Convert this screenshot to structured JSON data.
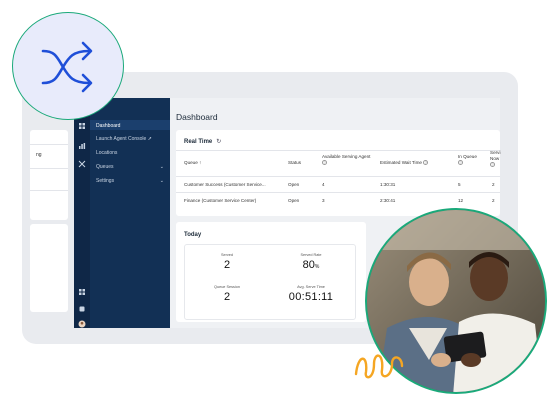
{
  "nav": {
    "items": [
      {
        "label": "Dashboard",
        "active": true
      },
      {
        "label": "Launch Agent Console",
        "icon": "external-link-icon"
      },
      {
        "label": "Locations"
      },
      {
        "label": "Queues",
        "expandable": true
      },
      {
        "label": "Settings",
        "expandable": true
      }
    ]
  },
  "left_pane": {
    "label": "ng"
  },
  "page": {
    "title": "Dashboard"
  },
  "realtime": {
    "title": "Real Time",
    "columns": [
      {
        "label": "Queue",
        "sort": "asc"
      },
      {
        "label": "Status"
      },
      {
        "label": "Available Serving Agent",
        "info": true
      },
      {
        "label": "Estimated Wait Time",
        "info": true
      },
      {
        "label": "In Queue",
        "info": true
      },
      {
        "label": "Servi Now",
        "info": true
      }
    ],
    "rows": [
      [
        "Customer Success (Customer Service...",
        "Open",
        "4",
        "1:30:31",
        "5",
        "2"
      ],
      [
        "Finance (Customer Service Center)",
        "Open",
        "3",
        "2:30:41",
        "12",
        "2"
      ]
    ]
  },
  "today": {
    "title": "Today",
    "stats": [
      {
        "label": "Served",
        "value": "2",
        "unit": ""
      },
      {
        "label": "Served Rate",
        "value": "80",
        "unit": "%"
      },
      {
        "label": "Queue Session",
        "value": "2",
        "unit": ""
      },
      {
        "label": "Avg. Serve Time",
        "value": "00:51:11",
        "unit": ""
      }
    ]
  },
  "colors": {
    "brand_green": "#1aa97a",
    "brand_blue": "#1f4fd8",
    "nav_bg": "#123055",
    "accent_orange": "#f5a623"
  }
}
